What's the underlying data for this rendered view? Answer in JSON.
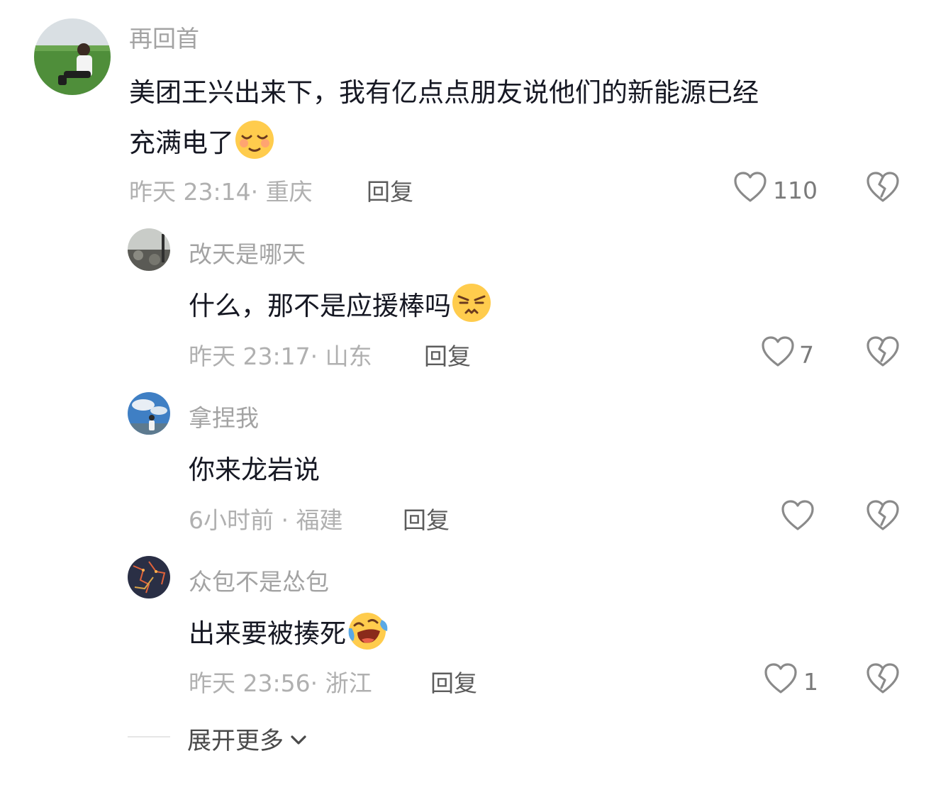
{
  "comments": [
    {
      "username": "再回首",
      "text_before": "美团王兴出来下，我有亿点点朋友说他们的新能源已经",
      "text_line2": "充满电了",
      "emoji": "smile-eyes-closed-emoji",
      "time": "昨天 23:14",
      "location": "重庆",
      "reply_label": "回复",
      "likes": "110"
    },
    {
      "username": "改天是哪天",
      "text": "什么，那不是应援棒吗",
      "emoji": "squinting-annoyed-emoji",
      "time": "昨天 23:17",
      "location": "山东",
      "reply_label": "回复",
      "likes": "7"
    },
    {
      "username": "拿捏我",
      "text": "你来龙岩说",
      "time": "6小时前",
      "location": "福建",
      "reply_label": "回复",
      "likes": ""
    },
    {
      "username": "众包不是怂包",
      "text": "出来要被揍死",
      "emoji": "crying-laughing-emoji",
      "time": "昨天 23:56",
      "location": "浙江",
      "reply_label": "回复",
      "likes": "1"
    }
  ],
  "expand": {
    "label": "展开更多"
  },
  "icons": {
    "like": "heart-outline-icon",
    "dislike": "broken-heart-icon",
    "expand": "chevron-down-icon"
  },
  "colors": {
    "text": "#161823",
    "secondary": "#a3a3a3",
    "reply": "#5c5c5c"
  }
}
